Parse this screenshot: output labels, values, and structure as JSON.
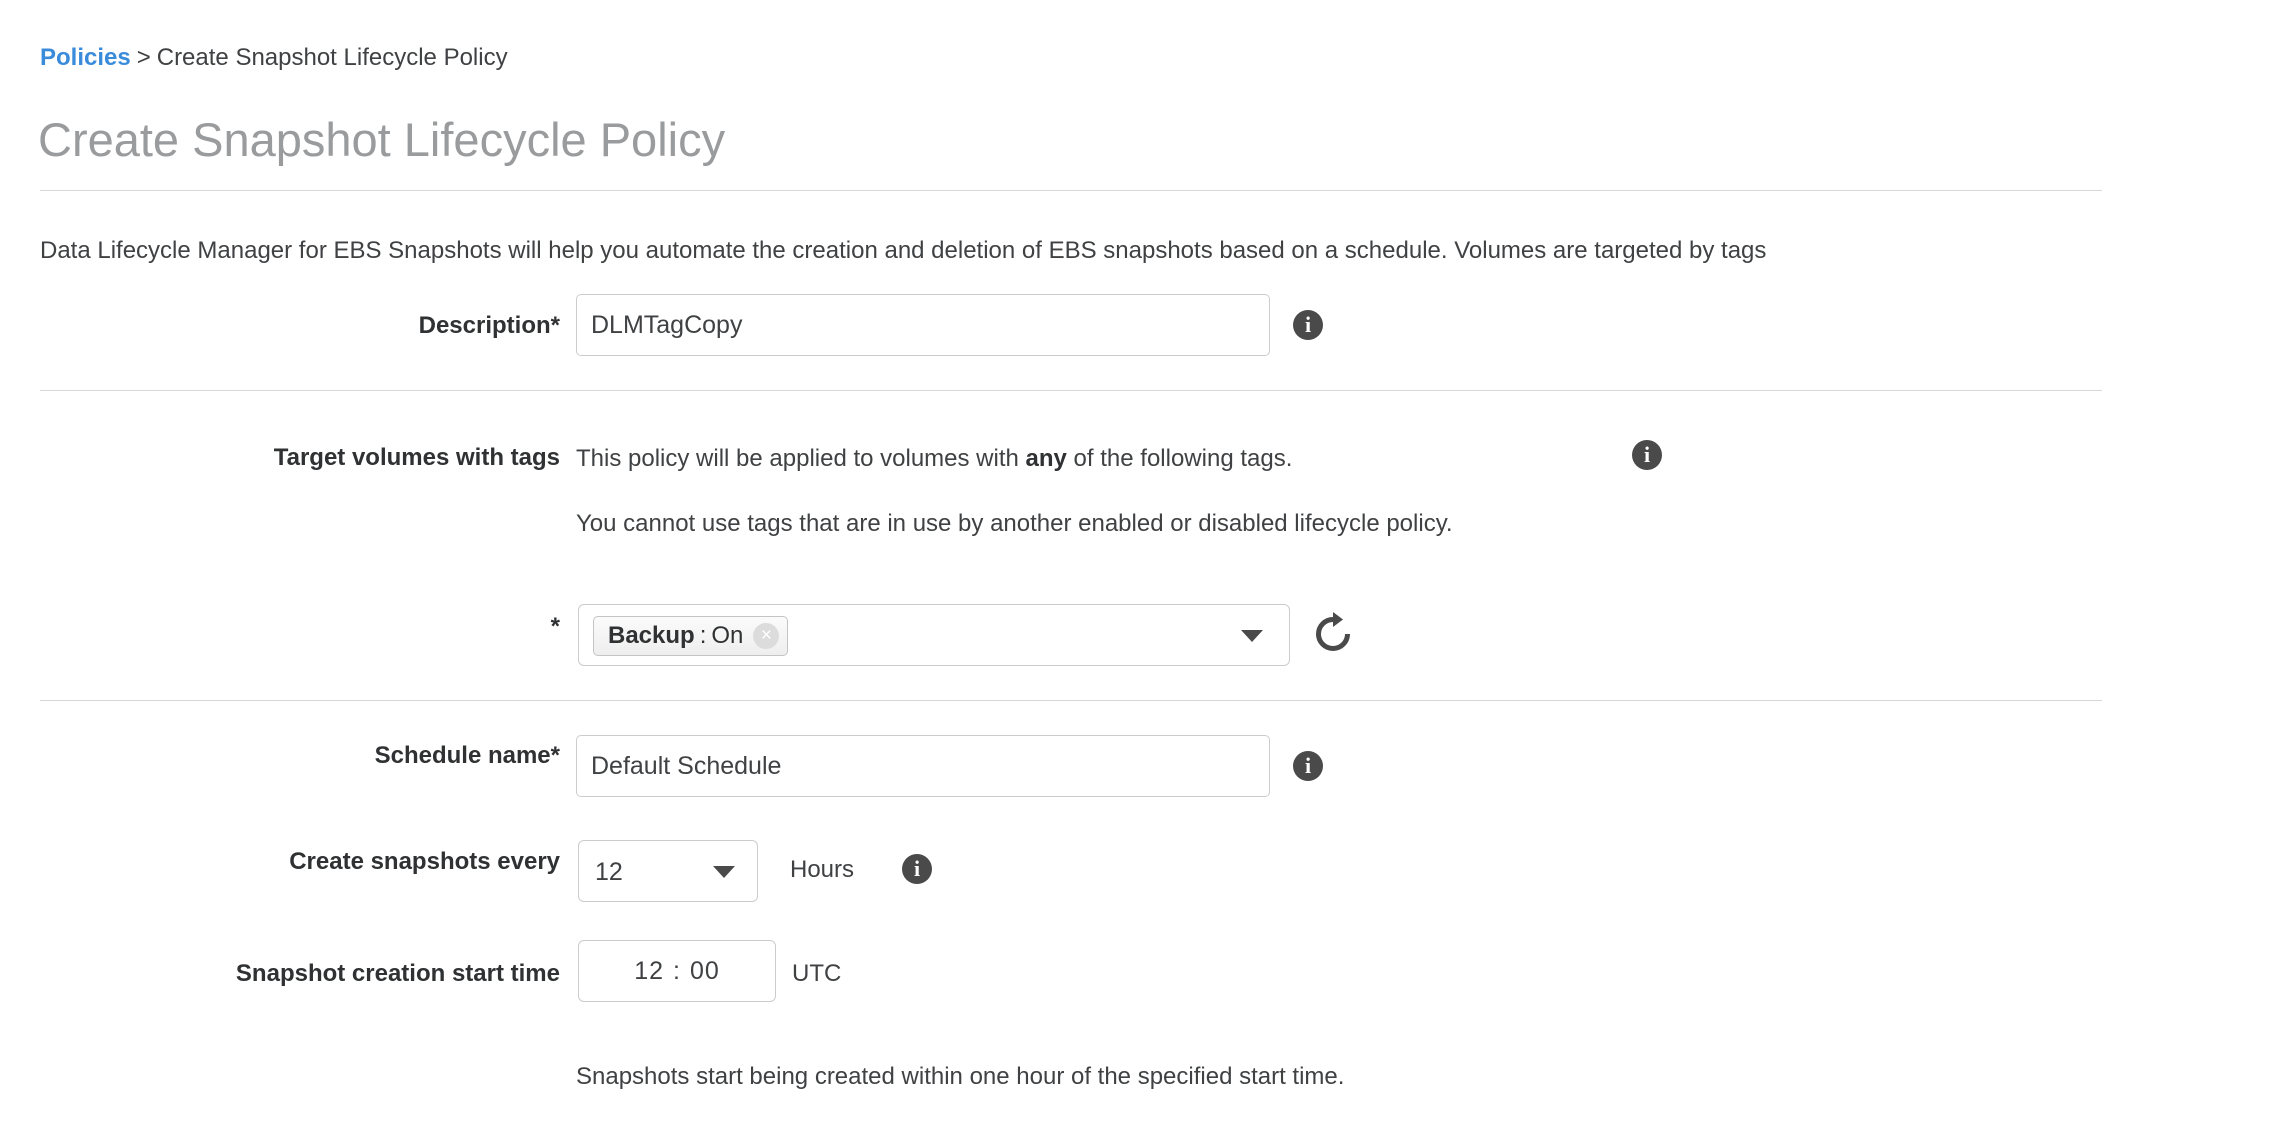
{
  "breadcrumb": {
    "link_label": "Policies",
    "separator": ">",
    "current_label": "Create Snapshot Lifecycle Policy"
  },
  "page_title": "Create Snapshot Lifecycle Policy",
  "intro_text": "Data Lifecycle Manager for EBS Snapshots will help you automate the creation and deletion of EBS snapshots based on a schedule. Volumes are targeted by tags",
  "description_section": {
    "label": "Description*",
    "value": "DLMTagCopy",
    "placeholder": "",
    "info_icon": "info-icon",
    "info_glyph": "i"
  },
  "target_volumes_section": {
    "label": "Target volumes with tags",
    "line1_prefix": "This policy will be applied to volumes with ",
    "line1_bold": "any",
    "line1_suffix": " of the following tags.",
    "line2": "You cannot use tags that are in use by another enabled or disabled lifecycle policy.",
    "required_marker": "*",
    "info_icon": "info-icon",
    "info_glyph": "i",
    "tag_chip": {
      "key": "Backup",
      "separator": ":",
      "value": "On",
      "remove_glyph": "×"
    },
    "dropdown_icon": "chevron-down-icon",
    "refresh_icon": "refresh-icon"
  },
  "schedule_section": {
    "name_label": "Schedule name*",
    "name_value": "Default Schedule",
    "name_placeholder": "",
    "name_info_glyph": "i",
    "interval_label": "Create snapshots every",
    "interval_value": "12",
    "interval_unit": "Hours",
    "interval_info_glyph": "i",
    "start_time_label": "Snapshot creation start time",
    "start_time_hours": "12",
    "start_time_separator": ":",
    "start_time_minutes": "00",
    "start_time_zone": "UTC",
    "hint": "Snapshots start being created within one hour of the specified start time."
  },
  "colors": {
    "link": "#3b8bdb",
    "title": "#999b9d",
    "text": "#3f4143",
    "border": "#cccccc",
    "rule": "#d8d8d8",
    "info_badge": "#4a4a4a"
  }
}
